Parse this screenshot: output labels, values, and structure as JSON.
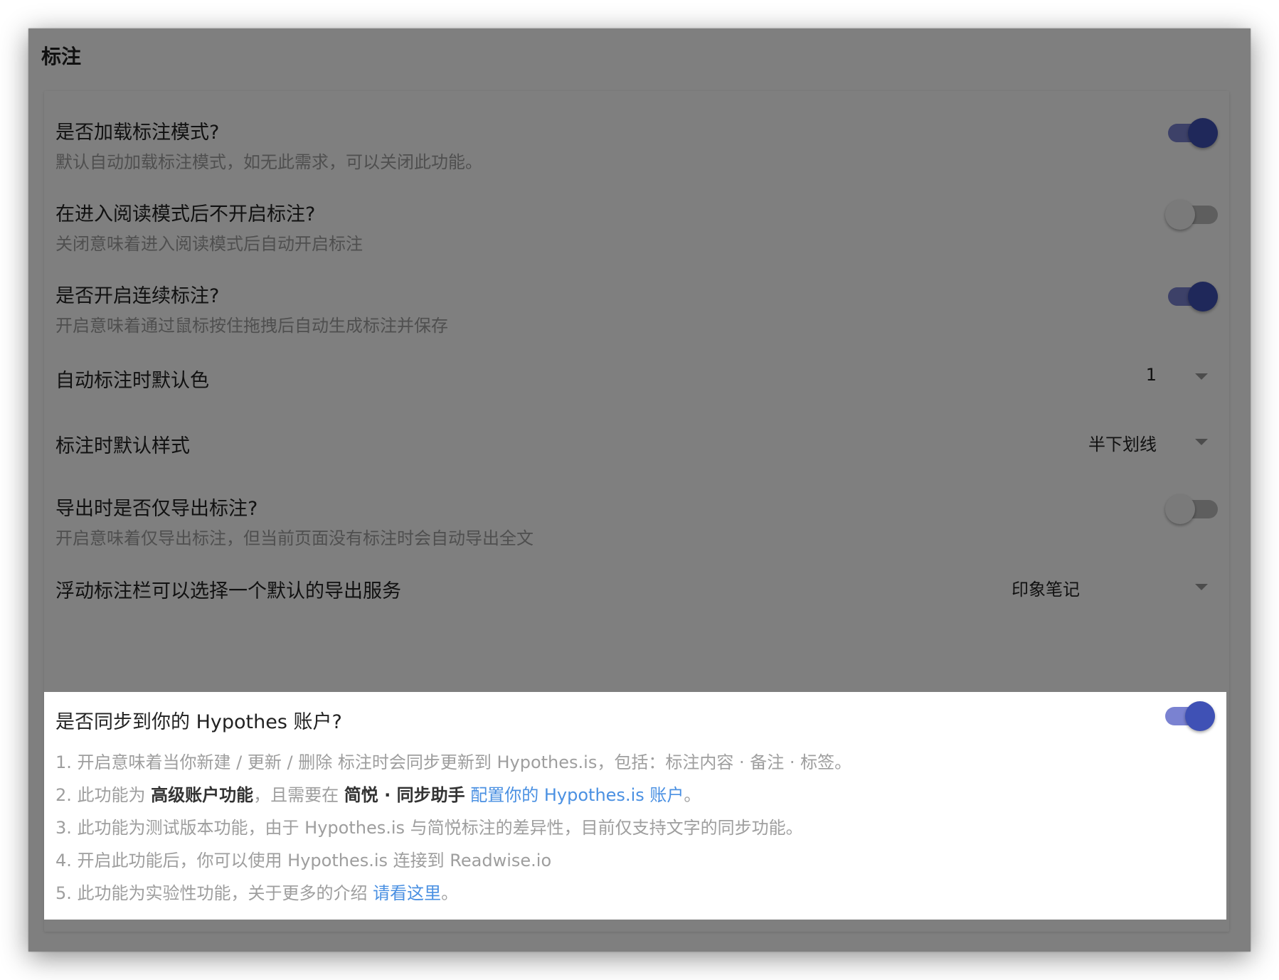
{
  "section": {
    "title": "标注"
  },
  "settings": [
    {
      "title": "是否加载标注模式?",
      "description": "默认自动加载标注模式，如无此需求，可以关闭此功能。",
      "control": "toggle",
      "checked": true
    },
    {
      "title": "在进入阅读模式后不开启标注?",
      "description": "关闭意味着进入阅读模式后自动开启标注",
      "control": "toggle",
      "checked": false
    },
    {
      "title": "是否开启连续标注?",
      "description": "开启意味着通过鼠标按住拖拽后自动生成标注并保存",
      "control": "toggle",
      "checked": true
    },
    {
      "title": "自动标注时默认色",
      "control": "select",
      "selected": "1"
    },
    {
      "title": "标注时默认样式",
      "control": "select",
      "selected": "半下划线"
    },
    {
      "title": "导出时是否仅导出标注?",
      "description": "开启意味着仅导出标注，但当前页面没有标注时会自动导出全文",
      "control": "toggle",
      "checked": false
    },
    {
      "title": "浮动标注栏可以选择一个默认的导出服务",
      "control": "select",
      "selected": "印象笔记"
    }
  ],
  "hypothes": {
    "title": "是否同步到你的 Hypothes 账户?",
    "checked": true,
    "notes": {
      "line1": "1. 开启意味着当你新建 / 更新 / 删除 标注时会同步更新到 Hypothes.is，包括：标注内容 · 备注 · 标签。",
      "line2_prefix": "2. 此功能为 ",
      "line2_bold1": "高级账户功能",
      "line2_mid": "，且需要在 ",
      "line2_bold2": "简悦 · 同步助手",
      "line2_link": " 配置你的 Hypothes.is 账户",
      "line2_suffix": "。",
      "line3": "3. 此功能为测试版本功能，由于 Hypothes.is 与简悦标注的差异性，目前仅支持文字的同步功能。",
      "line4": "4. 开启此功能后，你可以使用 Hypothes.is 连接到 Readwise.io",
      "line5_prefix": "5. 此功能为实验性功能，关于更多的介绍 ",
      "line5_link": "请看这里",
      "line5_suffix": "。"
    }
  },
  "colors": {
    "accent": "#3f51b5",
    "accent_track": "#7a82d1",
    "link": "#4a90e2",
    "overlay": "rgba(0,0,0,0.5)"
  }
}
